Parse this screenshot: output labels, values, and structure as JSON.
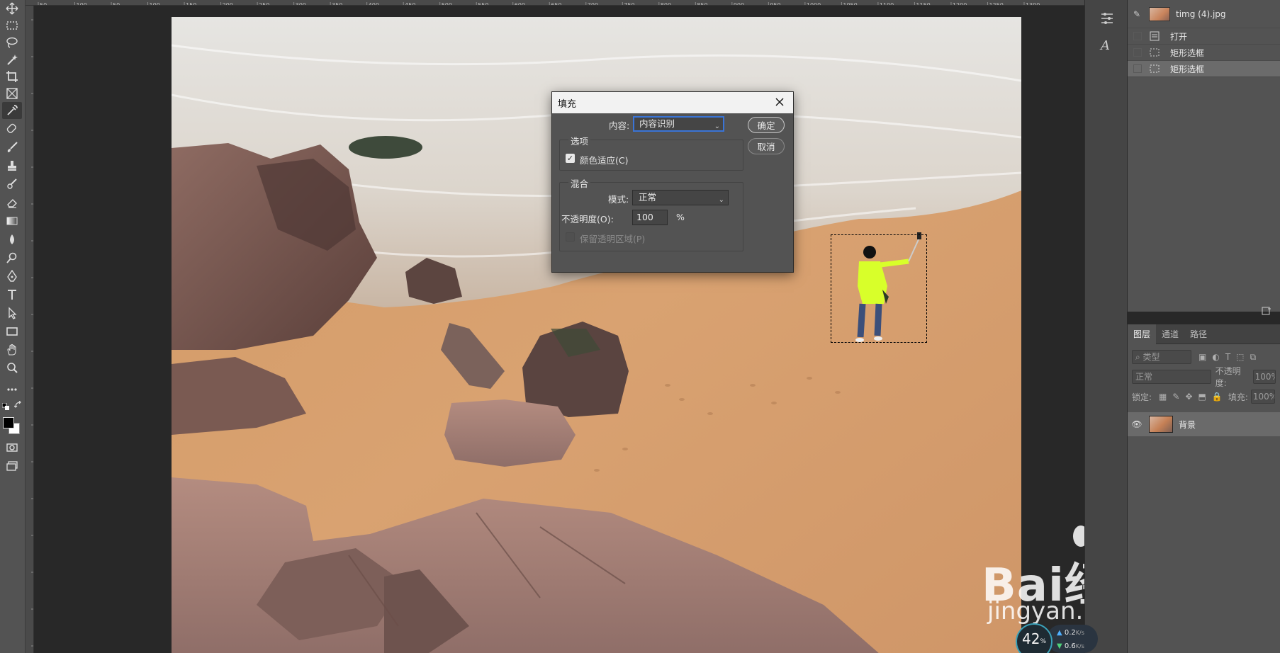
{
  "document": {
    "name": "timg (4).jpg"
  },
  "ruler_labels": [
    "50",
    "100",
    "50",
    "100",
    "150",
    "200",
    "250",
    "300",
    "350",
    "400",
    "450",
    "500",
    "550",
    "600",
    "650",
    "700",
    "750",
    "800",
    "850",
    "900",
    "950",
    "1000",
    "1050",
    "1100",
    "1150",
    "1200",
    "1250",
    "1300"
  ],
  "history": {
    "snapshot_label": "timg (4).jpg",
    "items": [
      {
        "label": "打开"
      },
      {
        "label": "矩形选框"
      },
      {
        "label": "矩形选框"
      }
    ]
  },
  "layers_panel": {
    "tabs": [
      "图层",
      "通道",
      "路径"
    ],
    "filter_placeholder": "类型",
    "blend_mode": "正常",
    "opacity_label": "不透明度:",
    "opacity_value": "100%",
    "lock_label": "锁定:",
    "fill_label": "填充:",
    "fill_value": "100%",
    "layer_name": "背景"
  },
  "fill_dialog": {
    "title": "填充",
    "content_label": "内容:",
    "content_value": "内容识别",
    "ok_label": "确定",
    "cancel_label": "取消",
    "options_title": "选项",
    "color_adapt_label": "颜色适应(C)",
    "color_adapt_checked": true,
    "blend_title": "混合",
    "mode_label": "模式:",
    "mode_value": "正常",
    "opacity_label": "不透明度(O):",
    "opacity_value": "100",
    "percent": "%",
    "preserve_label": "保留透明区域(P)",
    "preserve_checked": false
  },
  "watermark": {
    "brand": "Bai经验",
    "url": "jingyan.baidu.com"
  },
  "network": {
    "percent": "42",
    "percent_unit": "%",
    "up": "0.2",
    "down": "0.6",
    "unit": "K/s"
  },
  "colors": {
    "accent": "#3a74d6",
    "sand": "#d7a06c",
    "sea": "#e9e7e2",
    "rock": "#6b4a44",
    "jacket": "#d8ff2a"
  }
}
